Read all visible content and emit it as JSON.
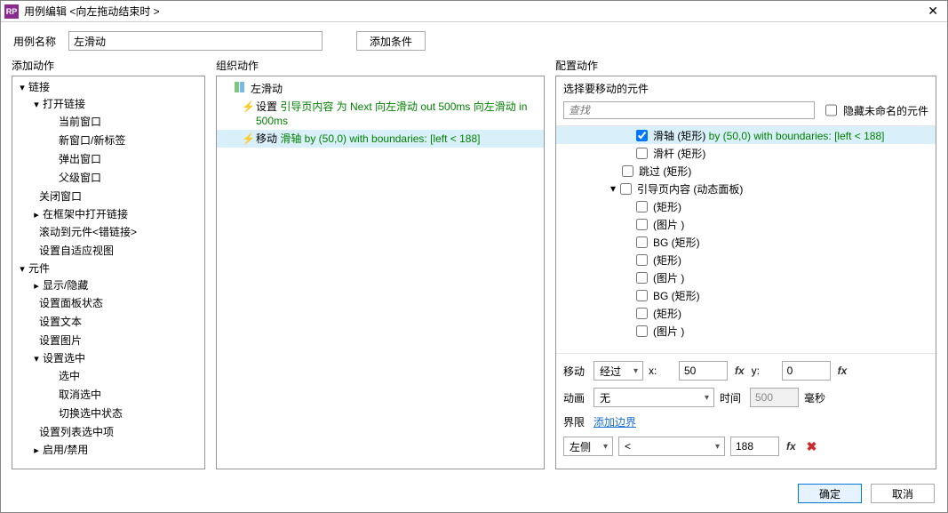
{
  "title": "用例编辑 <向左拖动结束时  >",
  "toprow": {
    "label": "用例名称",
    "value": "左滑动",
    "addCondition": "添加条件"
  },
  "colheads": {
    "left": "添加动作",
    "mid": "组织动作",
    "right": "配置动作"
  },
  "leftTree": {
    "g1": {
      "title": "链接",
      "i1": {
        "title": "打开链接",
        "c1": "当前窗口",
        "c2": "新窗口/新标签",
        "c3": "弹出窗口",
        "c4": "父级窗口"
      },
      "i2": "关闭窗口",
      "i3": "在框架中打开链接",
      "i4": "滚动到元件<错链接>",
      "i5": "设置自适应视图"
    },
    "g2": {
      "title": "元件",
      "i1": "显示/隐藏",
      "i2": "设置面板状态",
      "i3": "设置文本",
      "i4": "设置图片",
      "i5": {
        "title": "设置选中",
        "c1": "选中",
        "c2": "取消选中",
        "c3": "切换选中状态"
      },
      "i6": "设置列表选中项",
      "i7": "启用/禁用"
    }
  },
  "midTree": {
    "case": "左滑动",
    "a1": {
      "pre": "设置 ",
      "txt": "引导页内容 为 Next 向左滑动 out 500ms 向左滑动 in 500ms"
    },
    "a2": {
      "pre": "移动 ",
      "txt": "滑轴 by (50,0) with boundaries: [left < 188]"
    }
  },
  "rightPane": {
    "selectLabel": "选择要移动的元件",
    "searchPlaceholder": "查找",
    "hideUnnamed": "隐藏未命名的元件",
    "items": {
      "r0": {
        "name": "滑轴 (矩形)",
        "extra": " by (50,0) with boundaries: [left < 188]"
      },
      "r1": "滑杆 (矩形)",
      "r2": "跳过 (矩形)",
      "r3": "引导页内容 (动态面板)",
      "r4": "(矩形)",
      "r5": "(图片 )",
      "r6": "BG (矩形)",
      "r7": "(矩形)",
      "r8": "(图片 )",
      "r9": "BG (矩形)",
      "r10": "(矩形)",
      "r11": "(图片 )"
    }
  },
  "cfg": {
    "moveLabel": "移动",
    "moveMode": "经过",
    "xLabel": "x:",
    "xVal": "50",
    "yLabel": "y:",
    "yVal": "0",
    "animLabel": "动画",
    "animVal": "无",
    "timeLabel": "时间",
    "timeVal": "500",
    "timeUnit": "毫秒",
    "boundLabel": "界限",
    "addBound": "添加边界",
    "side": "左侧",
    "op": "<",
    "val": "188"
  },
  "dlg": {
    "ok": "确定",
    "cancel": "取消"
  }
}
